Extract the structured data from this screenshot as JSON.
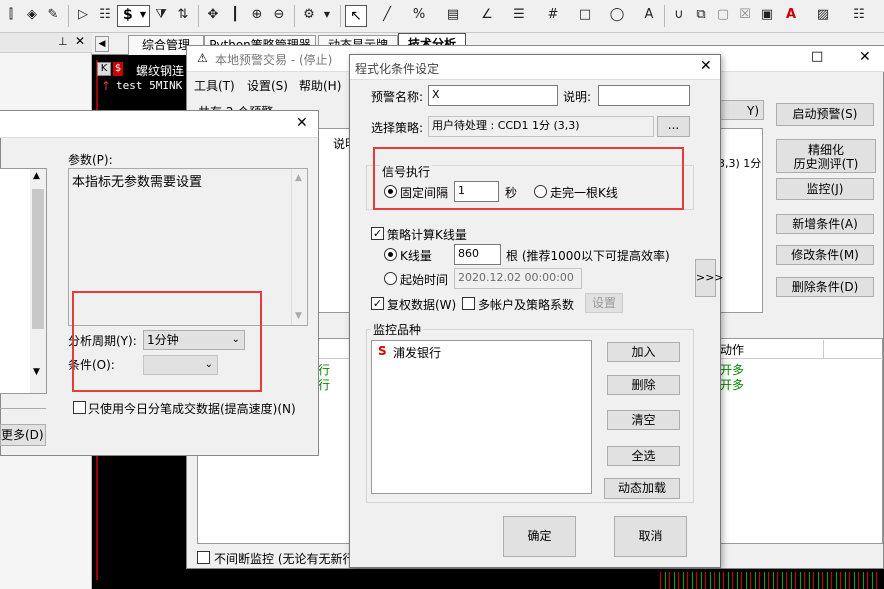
{
  "toolbar": {
    "icons": [
      "chart-bars-icon",
      "alert-icon",
      "edit-icon",
      "play-icon",
      "doc-icon",
      "dollar-icon",
      "filter-icon",
      "sort-icon",
      "move-icon",
      "vertical-bar-icon",
      "zoom-in-icon",
      "zoom-out-icon",
      "gear-icon",
      "cursor-icon",
      "line-icon",
      "percent-icon",
      "grid-icon",
      "angle-icon",
      "fib-icon",
      "hash-icon",
      "rect-icon",
      "circle-icon",
      "text-icon",
      "magnet-icon",
      "copy-icon",
      "delete-icon",
      "lock-icon",
      "font-color-icon",
      "save-icon",
      "list-icon"
    ],
    "dollar_label": "$",
    "text_label": "A"
  },
  "tabs": [
    "综合管理",
    "Python策略管理器",
    "动态显示牌",
    "技术分析"
  ],
  "background_chart": {
    "k_badge": "K",
    "s_badge": "$",
    "title": "螺纹钢连",
    "subtitle": "test 5MINK"
  },
  "warning_window": {
    "title": "本地预警交易 - (停止)",
    "menu": [
      "工具(T)",
      "设置(S)",
      "帮助(H)"
    ],
    "count_label": "共有 2 个预警",
    "col_desc": "说明",
    "col_action": "动作",
    "partial_top_btn": "Y)",
    "partial_row_text": "3,3) 1分",
    "buttons": [
      "启动预警(S)",
      "精细化\n历史测评(T)",
      "监控(J)",
      "新增条件(A)",
      "修改条件(M)",
      "删除条件(D)"
    ],
    "rows": [
      {
        "left": "行",
        "action": "开多"
      },
      {
        "left": "行",
        "action": "开多"
      }
    ],
    "continuous_label": "不间断监控 (无论有无新行"
  },
  "indicator_dialog": {
    "param_label": "参数(P):",
    "param_text": "本指标无参数需要设置",
    "period_label": "分析周期(Y):",
    "period_value": "1分钟",
    "condition_label": "条件(O):",
    "condition_value": "",
    "only_today_label": "只使用今日分笔成交数据(提高速度)(N)",
    "more_button": "更多(D)"
  },
  "condition_dialog": {
    "title": "程式化条件设定",
    "alert_name_label": "预警名称:",
    "alert_name_value": "X",
    "desc_label": "说明:",
    "desc_value": "",
    "strategy_label": "选择策略:",
    "strategy_value": "用户待处理 : CCD1 1分 (3,3)",
    "browse_button": "...",
    "signal_group": "信号执行",
    "fixed_interval_label": "固定间隔",
    "fixed_interval_value": "1",
    "seconds_label": "秒",
    "bar_complete_label": "走完一根K线",
    "calc_kline_label": "策略计算K线量",
    "kline_count_label": "K线量",
    "kline_count_value": "860",
    "kline_hint": "根 (推荐1000以下可提高效率)",
    "start_time_label": "起始时间",
    "start_time_value": "2020.12.02 00:00:00",
    "expand_button": ">>>",
    "adjust_label": "复权数据(W)",
    "multi_account_label": "多帐户及策略系数",
    "settings_button": "设置",
    "monitor_group": "监控品种",
    "monitor_items": [
      {
        "badge": "S",
        "name": "浦发银行"
      }
    ],
    "add_button": "加入",
    "delete_button": "删除",
    "clear_button": "清空",
    "select_all_button": "全选",
    "dynamic_load_button": "动态加载",
    "ok_button": "确定",
    "cancel_button": "取消"
  }
}
